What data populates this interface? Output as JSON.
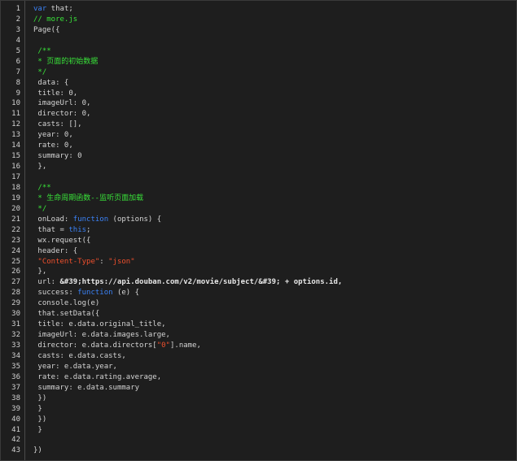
{
  "editor": {
    "lines": [
      [
        {
          "t": "var",
          "c": "kw"
        },
        {
          "t": " that;",
          "c": "plain"
        }
      ],
      [
        {
          "t": "// more.js",
          "c": "cm"
        }
      ],
      [
        {
          "t": "Page({",
          "c": "plain"
        }
      ],
      [],
      [
        {
          "t": " /**",
          "c": "cm"
        }
      ],
      [
        {
          "t": " * 页面的初始数据",
          "c": "cm"
        }
      ],
      [
        {
          "t": " */",
          "c": "cm"
        }
      ],
      [
        {
          "t": " data: {",
          "c": "plain"
        }
      ],
      [
        {
          "t": " title: 0,",
          "c": "plain"
        }
      ],
      [
        {
          "t": " imageUrl: 0,",
          "c": "plain"
        }
      ],
      [
        {
          "t": " director: 0,",
          "c": "plain"
        }
      ],
      [
        {
          "t": " casts: [],",
          "c": "plain"
        }
      ],
      [
        {
          "t": " year: 0,",
          "c": "plain"
        }
      ],
      [
        {
          "t": " rate: 0,",
          "c": "plain"
        }
      ],
      [
        {
          "t": " summary: 0",
          "c": "plain"
        }
      ],
      [
        {
          "t": " },",
          "c": "plain"
        }
      ],
      [],
      [
        {
          "t": " /**",
          "c": "cm"
        }
      ],
      [
        {
          "t": " * 生命周期函数--监听页面加载",
          "c": "cm"
        }
      ],
      [
        {
          "t": " */",
          "c": "cm"
        }
      ],
      [
        {
          "t": " onLoad: ",
          "c": "plain"
        },
        {
          "t": "function",
          "c": "kw"
        },
        {
          "t": " (options) {",
          "c": "plain"
        }
      ],
      [
        {
          "t": " that = ",
          "c": "plain"
        },
        {
          "t": "this",
          "c": "kw"
        },
        {
          "t": ";",
          "c": "plain"
        }
      ],
      [
        {
          "t": " wx.request({",
          "c": "plain"
        }
      ],
      [
        {
          "t": " header: {",
          "c": "plain"
        }
      ],
      [
        {
          "t": " \"Content-Type\"",
          "c": "str"
        },
        {
          "t": ": ",
          "c": "plain"
        },
        {
          "t": "\"json\"",
          "c": "str"
        }
      ],
      [
        {
          "t": " },",
          "c": "plain"
        }
      ],
      [
        {
          "t": " url: ",
          "c": "plain"
        },
        {
          "t": "&#39;https://api.douban.com/v2/movie/subject/&#39; + options.id,",
          "c": "url"
        }
      ],
      [
        {
          "t": " success: ",
          "c": "plain"
        },
        {
          "t": "function",
          "c": "kw"
        },
        {
          "t": " (e) {",
          "c": "plain"
        }
      ],
      [
        {
          "t": " console.log(e)",
          "c": "plain"
        }
      ],
      [
        {
          "t": " that.setData({",
          "c": "plain"
        }
      ],
      [
        {
          "t": " title: e.data.original_title,",
          "c": "plain"
        }
      ],
      [
        {
          "t": " imageUrl: e.data.images.large,",
          "c": "plain"
        }
      ],
      [
        {
          "t": " director: e.data.directors[",
          "c": "plain"
        },
        {
          "t": "\"0\"",
          "c": "str"
        },
        {
          "t": "].name,",
          "c": "plain"
        }
      ],
      [
        {
          "t": " casts: e.data.casts,",
          "c": "plain"
        }
      ],
      [
        {
          "t": " year: e.data.year,",
          "c": "plain"
        }
      ],
      [
        {
          "t": " rate: e.data.rating.average,",
          "c": "plain"
        }
      ],
      [
        {
          "t": " summary: e.data.summary",
          "c": "plain"
        }
      ],
      [
        {
          "t": " })",
          "c": "plain"
        }
      ],
      [
        {
          "t": " }",
          "c": "plain"
        }
      ],
      [
        {
          "t": " })",
          "c": "plain"
        }
      ],
      [
        {
          "t": " }",
          "c": "plain"
        }
      ],
      [],
      [
        {
          "t": "})",
          "c": "plain"
        }
      ]
    ]
  }
}
